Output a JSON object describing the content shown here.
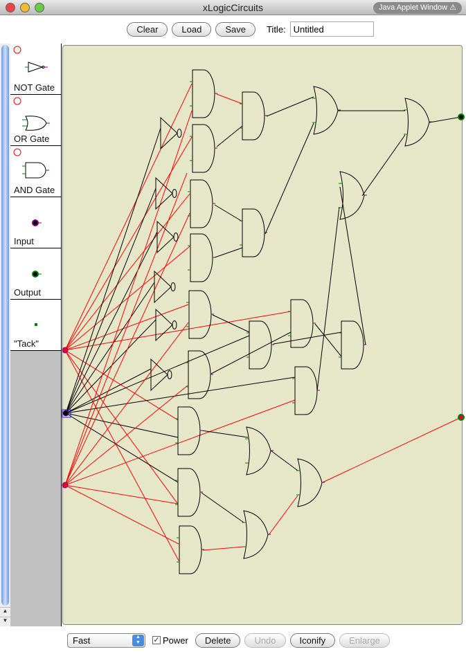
{
  "window": {
    "title": "xLogicCircuits",
    "badge": "Java Applet Window ⚠"
  },
  "toolbar": {
    "clear": "Clear",
    "load": "Load",
    "save": "Save",
    "title_label": "Title:",
    "title_value": "Untitled"
  },
  "palette": {
    "items": [
      {
        "label": "NOT Gate",
        "icon": "not-gate-icon"
      },
      {
        "label": "OR Gate",
        "icon": "or-gate-icon"
      },
      {
        "label": "AND Gate",
        "icon": "and-gate-icon"
      },
      {
        "label": "Input",
        "icon": "input-icon"
      },
      {
        "label": "Output",
        "icon": "output-icon"
      },
      {
        "label": "\"Tack\"",
        "icon": "tack-icon"
      }
    ]
  },
  "bottom": {
    "speed": "Fast",
    "power_label": "Power",
    "power_checked": true,
    "delete": "Delete",
    "undo": "Undo",
    "iconify": "Iconify",
    "enlarge": "Enlarge"
  },
  "colors": {
    "canvas": "#e6e6c8",
    "wire_on": "#ff0000",
    "wire_off": "#000000",
    "input": "#e00030",
    "output": "#008800"
  }
}
